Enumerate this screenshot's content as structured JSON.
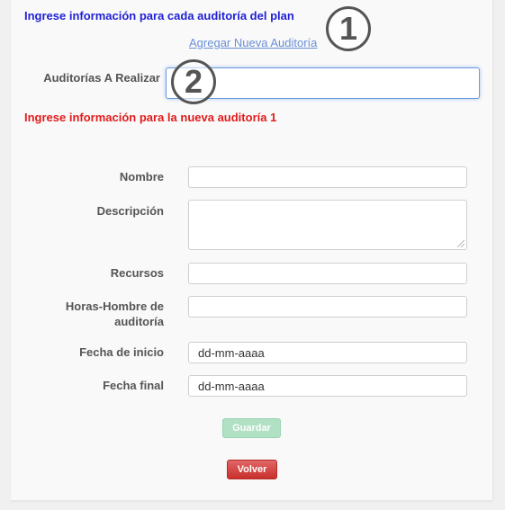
{
  "header": {
    "instructions": "Ingrese información para cada auditoría del plan",
    "add_link": "Agregar Nueva Auditoría"
  },
  "audits_field": {
    "label": "Auditorías A Realizar",
    "value": ""
  },
  "new_audit_heading": "Ingrese información para la nueva auditoría 1",
  "form": {
    "name_label": "Nombre",
    "name_value": "",
    "description_label": "Descripción",
    "description_value": "",
    "resources_label": "Recursos",
    "resources_value": "",
    "hours_label_line1": "Horas-Hombre de",
    "hours_label_line2": "auditoría",
    "hours_value": "",
    "start_label": "Fecha de inicio",
    "start_placeholder": "dd-mm-aaaa",
    "end_label": "Fecha final",
    "end_placeholder": "dd-mm-aaaa"
  },
  "buttons": {
    "save": "Guardar",
    "back": "Volver"
  },
  "annotations": {
    "marker1": "1",
    "marker2": "2"
  },
  "colors": {
    "heading_blue": "#1f1fd6",
    "heading_red": "#e21b1b",
    "link": "#6b8fd6",
    "save_button": "#a9dfbf",
    "back_button": "#d9534f"
  }
}
